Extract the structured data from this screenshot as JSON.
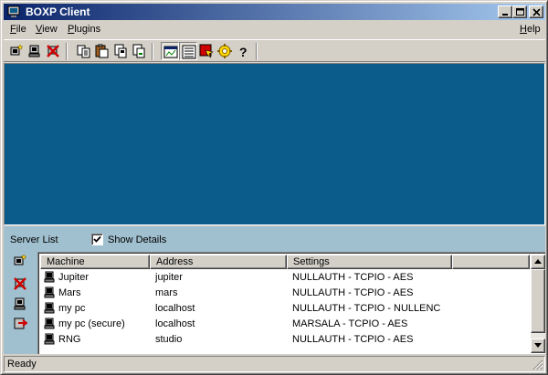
{
  "window": {
    "title": "BOXP Client"
  },
  "menu": {
    "file": {
      "key": "F",
      "rest": "ile"
    },
    "view": {
      "key": "V",
      "rest": "iew"
    },
    "plugins": {
      "key": "P",
      "rest": "lugins"
    },
    "help": {
      "key": "H",
      "rest": "elp"
    }
  },
  "toolbar_icons": [
    "new-connection-icon",
    "connect-icon",
    "disconnect-icon",
    "copy-icon",
    "paste-icon",
    "move-icon",
    "delete-icon",
    "view-icon",
    "details-icon",
    "stop-icon",
    "settings-icon",
    "help-icon"
  ],
  "server": {
    "label": "Server List",
    "show_details_label": "Show Details",
    "show_details_checked": true
  },
  "list": {
    "columns": [
      "Machine",
      "Address",
      "Settings"
    ],
    "rows": [
      {
        "machine": "Jupiter",
        "address": "jupiter",
        "settings": "NULLAUTH - TCPIO - AES"
      },
      {
        "machine": "Mars",
        "address": "mars",
        "settings": "NULLAUTH - TCPIO - AES"
      },
      {
        "machine": "my pc",
        "address": "localhost",
        "settings": "NULLAUTH - TCPIO - NULLENC"
      },
      {
        "machine": "my pc (secure)",
        "address": "localhost",
        "settings": "MARSALA - TCPIO - AES"
      },
      {
        "machine": "RNG",
        "address": "studio",
        "settings": "NULLAUTH - TCPIO - AES"
      }
    ]
  },
  "status": {
    "text": "Ready"
  },
  "colors": {
    "title_start": "#0a246a",
    "title_end": "#a6caf0",
    "main_area": "#0b5c8a",
    "panel": "#a0bfcf"
  }
}
